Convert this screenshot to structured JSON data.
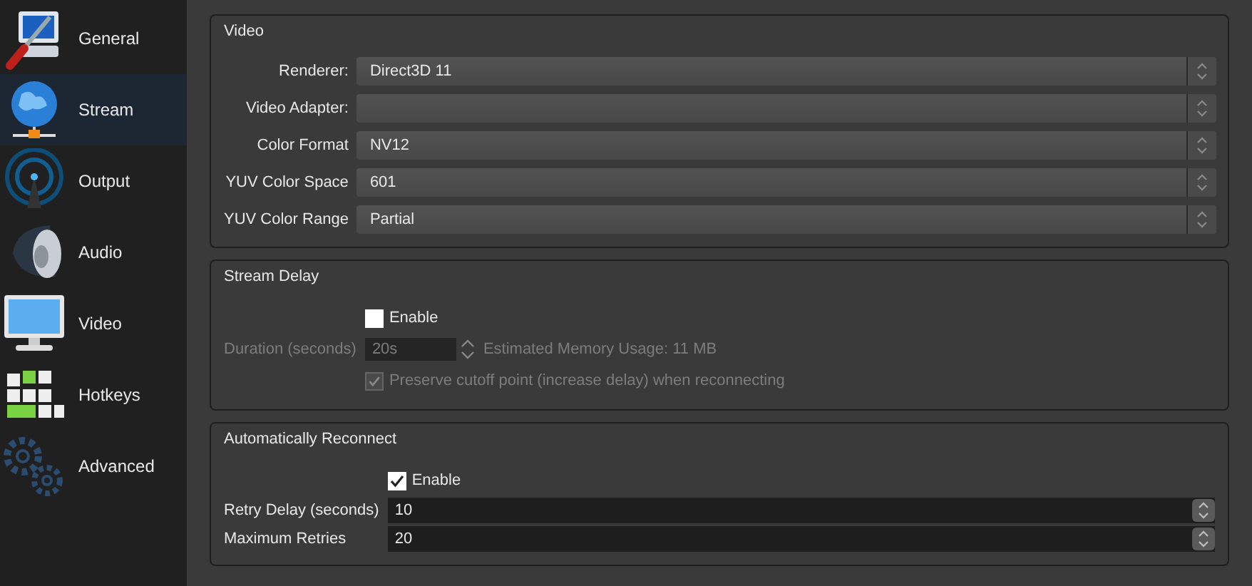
{
  "sidebar": {
    "items": [
      {
        "label": "General",
        "selected": false
      },
      {
        "label": "Stream",
        "selected": true
      },
      {
        "label": "Output",
        "selected": false
      },
      {
        "label": "Audio",
        "selected": false
      },
      {
        "label": "Video",
        "selected": false
      },
      {
        "label": "Hotkeys",
        "selected": false
      },
      {
        "label": "Advanced",
        "selected": false
      }
    ]
  },
  "video": {
    "title": "Video",
    "fields": [
      {
        "label": "Renderer:",
        "value": "Direct3D 11"
      },
      {
        "label": "Video Adapter:"
      },
      {
        "label": "Color Format",
        "value": "NV12"
      },
      {
        "label": "YUV Color Space",
        "value": "601"
      },
      {
        "label": "YUV Color Range",
        "value": "Partial"
      }
    ]
  },
  "stream_delay": {
    "title": "Stream Delay",
    "enable": {
      "label": "Enable",
      "checked": false,
      "disabled": false
    },
    "duration": {
      "label": "Duration (seconds)",
      "value": "20s",
      "disabled": true
    },
    "memory_usage": "Estimated Memory Usage: 11 MB",
    "preserve": {
      "label": "Preserve cutoff point (increase delay) when reconnecting",
      "checked": true,
      "disabled": true
    }
  },
  "reconnect": {
    "title": "Automatically Reconnect",
    "enable": {
      "label": "Enable",
      "checked": true,
      "disabled": false
    },
    "fields": [
      {
        "label": "Retry Delay (seconds)",
        "value": "10"
      },
      {
        "label": "Maximum Retries",
        "value": "20"
      }
    ]
  }
}
